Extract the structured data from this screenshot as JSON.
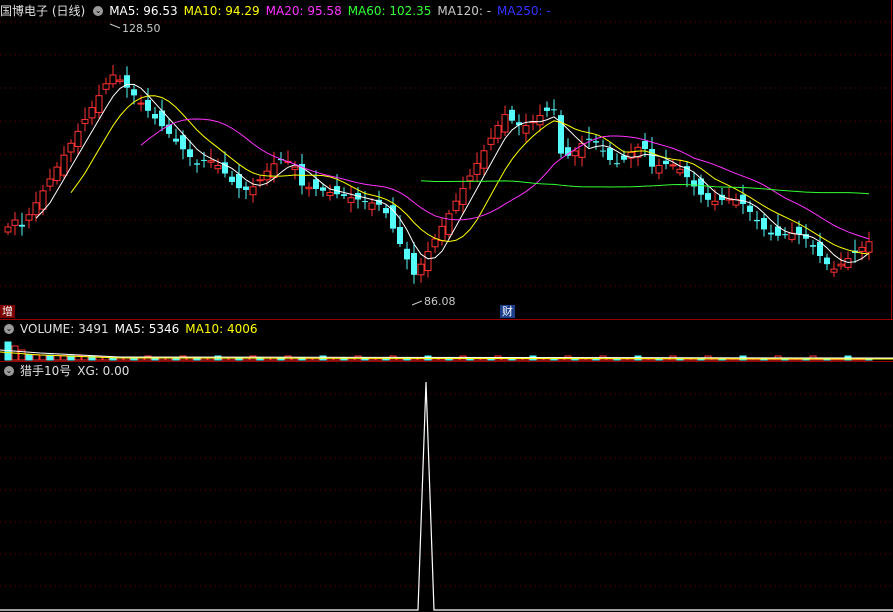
{
  "main_pane": {
    "stock_label": "国博电子 (日线)",
    "indicators": [
      {
        "label": "MA5: 96.53",
        "color": "#ffffff"
      },
      {
        "label": "MA10: 94.29",
        "color": "#ffff00"
      },
      {
        "label": "MA20: 95.58",
        "color": "#ff33ff"
      },
      {
        "label": "MA60: 102.35",
        "color": "#33ff33"
      },
      {
        "label": "MA120: -",
        "color": "#c8c8c8"
      },
      {
        "label": "MA250: -",
        "color": "#3333ff"
      }
    ],
    "high_label": "128.50",
    "low_label": "86.08",
    "left_badge": "增",
    "right_badge": "财",
    "colors": {
      "up": "#ff3232",
      "down": "#54fcfc"
    }
  },
  "volume_pane": {
    "title": "VOLUME: 3491",
    "ma5": "MA5: 5346",
    "ma10": "MA10: 4006"
  },
  "signal_pane": {
    "title": "猎手10号",
    "xg": "XG: 0.00"
  }
}
